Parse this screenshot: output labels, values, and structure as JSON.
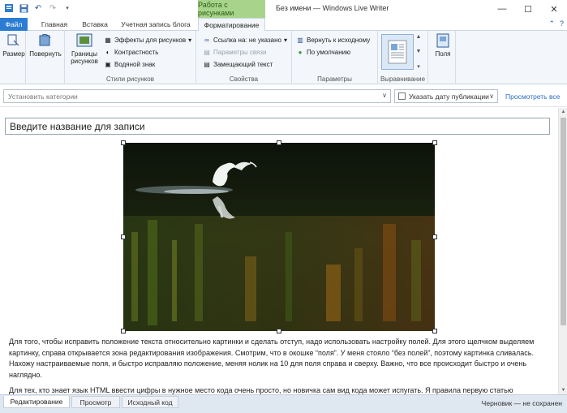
{
  "window": {
    "title": "Без имени — Windows Live Writer",
    "context_tab_group": "Работа с рисунками"
  },
  "tabs": {
    "file": "Файл",
    "home": "Главная",
    "insert": "Вставка",
    "account": "Учетная запись блога",
    "format": "Форматирование"
  },
  "ribbon": {
    "size": "Размер",
    "rotate": "Повернуть",
    "borders": "Границы рисунков",
    "effects": "Эффекты для рисунков",
    "contrast": "Контрастность",
    "watermark": "Водяной знак",
    "group_styles": "Стили рисунков",
    "link_to": "Ссылка на: не указано",
    "link_params": "Параметры связи",
    "alt_text": "Замещающий текст",
    "group_properties": "Свойства",
    "reset": "Вернуть к исходному",
    "default": "По умолчанию",
    "group_params": "Параметры",
    "group_align": "Выравнивание",
    "margins": "Поля"
  },
  "categories": {
    "placeholder": "Установить категории",
    "date_label": "Указать дату публикации",
    "preview_link": "Просмотреть все"
  },
  "post": {
    "title": "Введите название для записи",
    "paragraph1": "Для того, чтобы исправить положение текста относительно картинки и сделать отступ, надо использовать настройку полей. Для этого щелчком выделяем картинку, справа открывается зона редактирования изображения. Смотрим, что в окошке “поля”. У меня стояло “без полей”, поэтому картинка сливалась. Нахожу настраиваемые поля, и быстро исправляю положение, меняя нолик на 10 для поля справа и сверху. Важно, что все происходит быстро и очень наглядно.",
    "paragraph2": "Для тех, кто знает язык HTML ввести цифры в нужное место кода очень просто, но новичка сам вид кода может испугать. Я правила первую статью"
  },
  "view_tabs": {
    "edit": "Редактирование",
    "preview": "Просмотр",
    "source": "Исходный код"
  },
  "status": "Черновик — не сохранен",
  "colors": {
    "accent": "#2b7cd3",
    "context_tab": "#a7d48a"
  }
}
